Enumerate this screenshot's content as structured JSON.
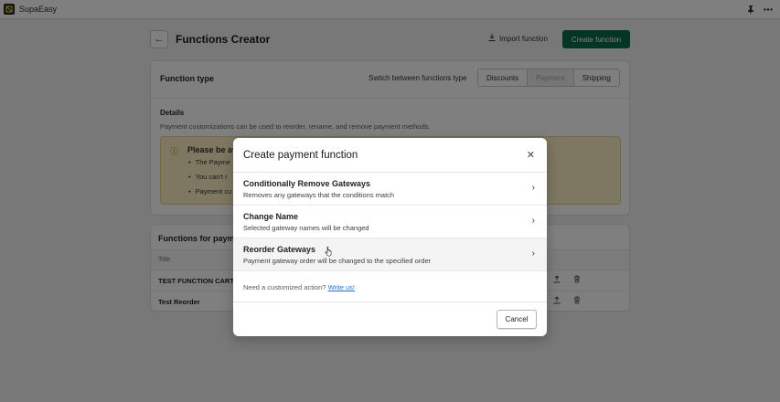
{
  "app": {
    "name": "SupaEasy"
  },
  "page": {
    "title": "Functions Creator",
    "import_label": "Import function",
    "create_label": "Create function"
  },
  "function_type": {
    "label": "Function type",
    "switch_label": "Swtich between functions type",
    "options": [
      "Discounts",
      "Payment",
      "Shipping"
    ],
    "selected": "Payment"
  },
  "details": {
    "title": "Details",
    "description": "Payment customizations can be used to reorder, rename, and remove payment methods.",
    "banner_title": "Please be av",
    "banner_items": [
      "The Payme",
      "You can't r",
      "Payment cu"
    ]
  },
  "functions_list": {
    "title": "Functions for paym",
    "column_title": "Title",
    "rows": [
      "TEST FUNCTION CART",
      "Test Reorder"
    ]
  },
  "modal": {
    "title": "Create payment function",
    "options": [
      {
        "title": "Conditionally Remove Gateways",
        "description": "Removes any gateways that the conditions match"
      },
      {
        "title": "Change Name",
        "description": "Selected gateway names will be changed"
      },
      {
        "title": "Reorder Gateways",
        "description": "Payment gateway order will be changed to the specified order"
      }
    ],
    "custom_prompt": "Need a customized action?",
    "custom_link": "Write us!",
    "cancel_label": "Cancel"
  },
  "colors": {
    "primary_button": "#0b6b4b",
    "link": "#2c6ecb",
    "banner_bg": "#fcefc3"
  }
}
